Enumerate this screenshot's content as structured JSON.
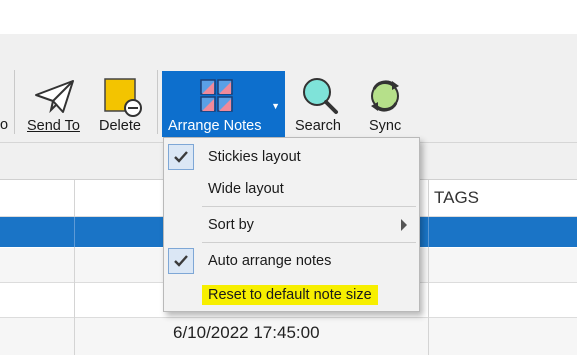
{
  "ribbon": {
    "partial_left_label": "o",
    "send_to": "Send To",
    "delete": "Delete",
    "arrange_notes": "Arrange Notes",
    "search": "Search",
    "sync": "Sync"
  },
  "grid": {
    "header_tags": "TAGS",
    "row_date": "6/10/2022 17:45:00"
  },
  "menu": {
    "items": [
      {
        "label": "Stickies layout",
        "checked": true
      },
      {
        "label": "Wide layout",
        "checked": false
      },
      {
        "label": "Sort by",
        "has_submenu": true
      },
      {
        "label": "Auto arrange notes",
        "checked": true
      },
      {
        "label": "Reset to default note size",
        "highlighted": true
      }
    ]
  },
  "colors": {
    "accent": "#0d6fcd",
    "selected_row": "#1a74c6",
    "highlight": "#f7ef00"
  }
}
